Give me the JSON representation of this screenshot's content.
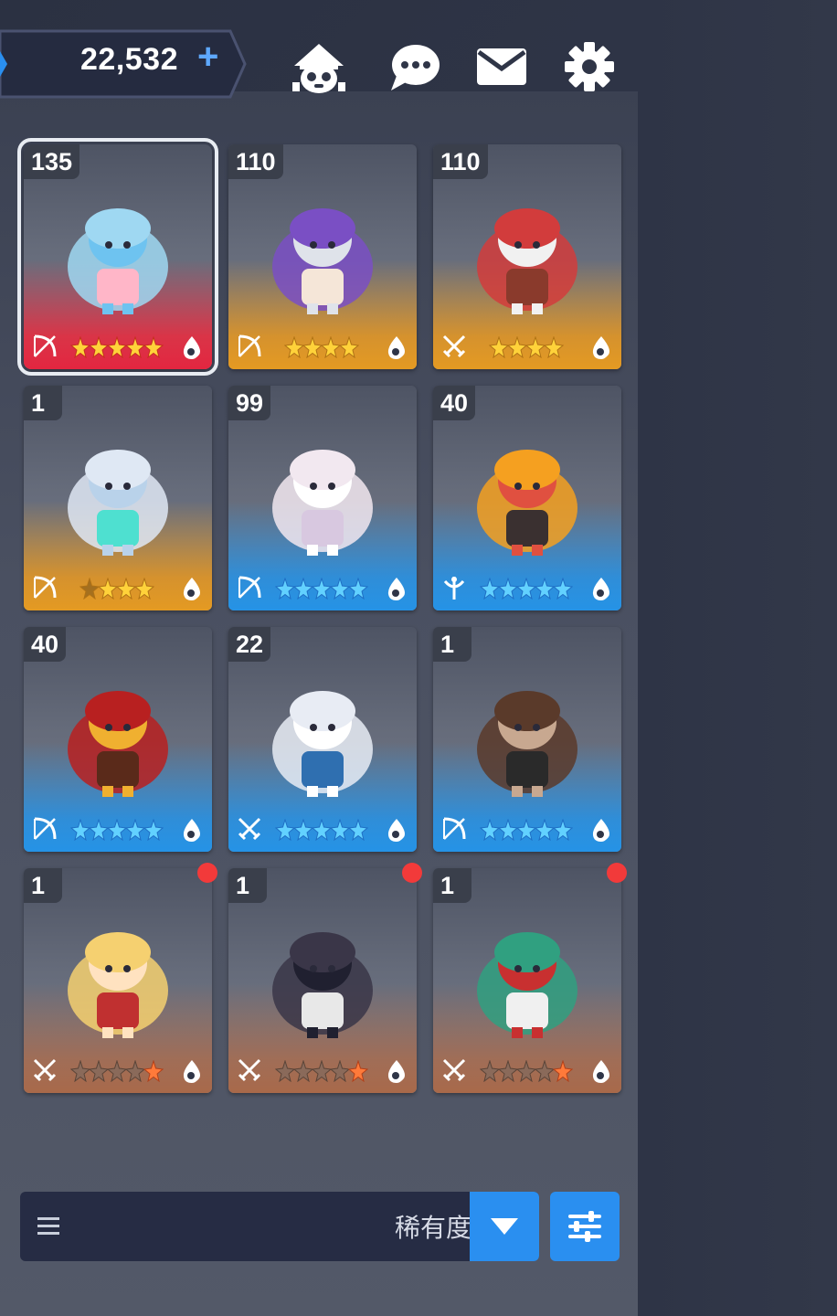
{
  "currency": {
    "value": "22,532",
    "plus": "+"
  },
  "top_icons": [
    "guild-icon",
    "chat-icon",
    "mail-icon",
    "settings-icon"
  ],
  "cards": [
    {
      "level": "135",
      "frame": "red",
      "stars": 5,
      "star_style": "red",
      "class_icon": "bow-icon",
      "element_icon": "water-drop-icon",
      "character": "mermaid-with-dragon",
      "selected": true,
      "new": false
    },
    {
      "level": "110",
      "frame": "gold",
      "stars": 4,
      "star_style": "gold",
      "class_icon": "bow-icon",
      "element_icon": "water-drop-icon",
      "character": "purple-hair-horned-girl",
      "selected": false,
      "new": false
    },
    {
      "level": "110",
      "frame": "gold",
      "stars": 4,
      "star_style": "gold",
      "class_icon": "sword-icon",
      "element_icon": "water-drop-icon",
      "character": "red-hair-demon-girl",
      "selected": false,
      "new": false
    },
    {
      "level": "1",
      "frame": "gold",
      "stars": 4,
      "star_style": "gold",
      "class_icon": "bow-icon",
      "element_icon": "water-drop-icon",
      "character": "white-hair-ice-mage",
      "selected": false,
      "new": false
    },
    {
      "level": "99",
      "frame": "blue",
      "stars": 5,
      "star_style": "blue",
      "class_icon": "bow-icon",
      "element_icon": "water-drop-icon",
      "character": "white-fox-girl",
      "selected": false,
      "new": false
    },
    {
      "level": "40",
      "frame": "blue",
      "stars": 5,
      "star_style": "blue",
      "class_icon": "staff-icon",
      "element_icon": "water-drop-icon",
      "character": "phoenix-wing-girl",
      "selected": false,
      "new": false
    },
    {
      "level": "40",
      "frame": "blue",
      "stars": 5,
      "star_style": "blue",
      "class_icon": "bow-icon",
      "element_icon": "water-drop-icon",
      "character": "pirate-hat-girl",
      "selected": false,
      "new": false
    },
    {
      "level": "22",
      "frame": "blue",
      "stars": 5,
      "star_style": "blue",
      "class_icon": "sword-icon",
      "element_icon": "water-drop-icon",
      "character": "white-horned-beast",
      "selected": false,
      "new": false
    },
    {
      "level": "1",
      "frame": "blue",
      "stars": 5,
      "star_style": "blue",
      "class_icon": "bow-icon",
      "element_icon": "water-drop-icon",
      "character": "archer-girl",
      "selected": false,
      "new": false
    },
    {
      "level": "1",
      "frame": "bronze",
      "stars": 5,
      "star_style": "bronze",
      "class_icon": "sword-icon",
      "element_icon": "water-drop-icon",
      "character": "blonde-cat-girl",
      "selected": false,
      "new": true
    },
    {
      "level": "1",
      "frame": "bronze",
      "stars": 5,
      "star_style": "bronze",
      "class_icon": "sword-icon",
      "element_icon": "water-drop-icon",
      "character": "dark-bear",
      "selected": false,
      "new": true
    },
    {
      "level": "1",
      "frame": "bronze",
      "stars": 5,
      "star_style": "bronze",
      "class_icon": "sword-icon",
      "element_icon": "water-drop-icon",
      "character": "green-hair-maid",
      "selected": false,
      "new": true
    }
  ],
  "sort": {
    "label": "稀有度"
  },
  "colors": {
    "accent": "#2a8ff0",
    "new_dot": "#f23a3a",
    "red": "#e32640",
    "gold": "#e49a22",
    "blue": "#2593e6",
    "bronze": "#a8694a"
  }
}
